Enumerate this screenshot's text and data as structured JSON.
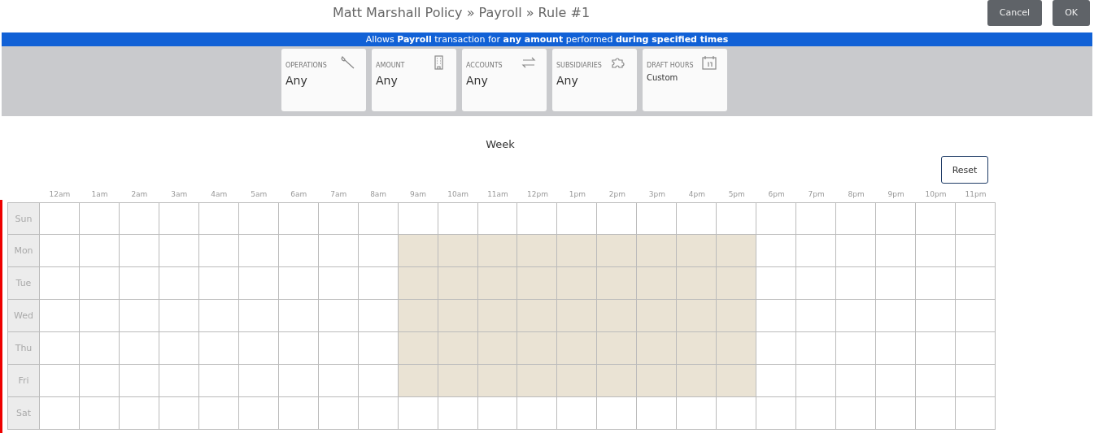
{
  "title": "Matt Marshall Policy » Payroll » Rule #1",
  "buttons": [
    "Cancel",
    "OK"
  ],
  "banner": "Allows **Payroll** transaction for **any amount** performed **during specified times**",
  "cards": [
    {
      "kind": "wrench",
      "label": "OPERATIONS",
      "value": "Any"
    },
    {
      "kind": "building",
      "label": "AMOUNT",
      "value": "Any"
    },
    {
      "kind": "arrows",
      "label": "ACCOUNTS",
      "value": "Any"
    },
    {
      "kind": "puzzle",
      "label": "SUBSIDIARIES",
      "value": "Any"
    },
    {
      "kind": "calendar",
      "label": "DRAFT HOURS",
      "value": "Custom"
    }
  ],
  "schedule": {
    "heading": "Week",
    "reset": "Reset",
    "hours": [
      "12am",
      "1am",
      "2am",
      "3am",
      "4am",
      "5am",
      "6am",
      "7am",
      "8am",
      "9am",
      "10am",
      "11am",
      "12pm",
      "1pm",
      "2pm",
      "3pm",
      "4pm",
      "5pm",
      "6pm",
      "7pm",
      "8pm",
      "9pm",
      "10pm",
      "11pm"
    ],
    "days": [
      {
        "label": "Sun",
        "selected": [
          false,
          false,
          false,
          false,
          false,
          false,
          false,
          false,
          false,
          false,
          false,
          false,
          false,
          false,
          false,
          false,
          false,
          false,
          false,
          false,
          false,
          false,
          false,
          false
        ]
      },
      {
        "label": "Mon",
        "selected": [
          false,
          false,
          false,
          false,
          false,
          false,
          false,
          false,
          false,
          true,
          true,
          true,
          true,
          true,
          true,
          true,
          true,
          true,
          false,
          false,
          false,
          false,
          false,
          false
        ]
      },
      {
        "label": "Tue",
        "selected": [
          false,
          false,
          false,
          false,
          false,
          false,
          false,
          false,
          false,
          true,
          true,
          true,
          true,
          true,
          true,
          true,
          true,
          true,
          false,
          false,
          false,
          false,
          false,
          false
        ]
      },
      {
        "label": "Wed",
        "selected": [
          false,
          false,
          false,
          false,
          false,
          false,
          false,
          false,
          false,
          true,
          true,
          true,
          true,
          true,
          true,
          true,
          true,
          true,
          false,
          false,
          false,
          false,
          false,
          false
        ]
      },
      {
        "label": "Thu",
        "selected": [
          false,
          false,
          false,
          false,
          false,
          false,
          false,
          false,
          false,
          true,
          true,
          true,
          true,
          true,
          true,
          true,
          true,
          true,
          false,
          false,
          false,
          false,
          false,
          false
        ]
      },
      {
        "label": "Fri",
        "selected": [
          false,
          false,
          false,
          false,
          false,
          false,
          false,
          false,
          false,
          true,
          true,
          true,
          true,
          true,
          true,
          true,
          true,
          true,
          false,
          false,
          false,
          false,
          false,
          false
        ]
      },
      {
        "label": "Sat",
        "selected": [
          false,
          false,
          false,
          false,
          false,
          false,
          false,
          false,
          false,
          false,
          false,
          false,
          false,
          false,
          false,
          false,
          false,
          false,
          false,
          false,
          false,
          false,
          false,
          false
        ]
      }
    ]
  }
}
